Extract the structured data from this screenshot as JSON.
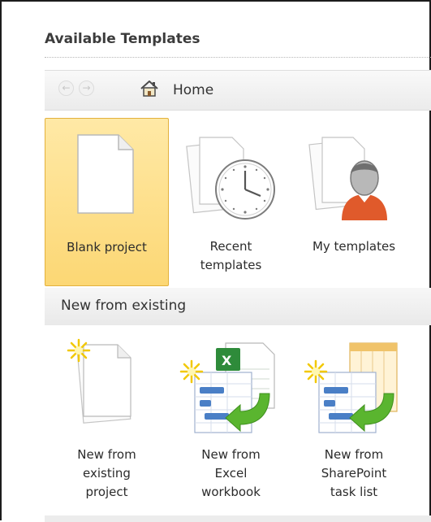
{
  "heading": "Available Templates",
  "navbar": {
    "back_icon": "back-arrow",
    "forward_icon": "forward-arrow",
    "home_label": "Home"
  },
  "tiles_top": [
    {
      "label": "Blank project",
      "icon": "blank-document",
      "selected": true
    },
    {
      "label": "Recent templates",
      "icon": "clock-documents",
      "selected": false
    },
    {
      "label": "My templates",
      "icon": "person-documents",
      "selected": false
    }
  ],
  "section": {
    "title": "New from existing"
  },
  "tiles_bottom": [
    {
      "label": "New from existing project",
      "icon": "new-document-star"
    },
    {
      "label": "New from Excel workbook",
      "icon": "excel-gantt"
    },
    {
      "label": "New from SharePoint task list",
      "icon": "sharepoint-gantt"
    }
  ],
  "colors": {
    "selection": "#fcd774",
    "excel_green": "#2e8b3a",
    "gantt_blue": "#4a7fc6",
    "arrow_green": "#5ab52f"
  },
  "labels": {
    "blank": [
      "Blank project"
    ],
    "recent": [
      "Recent",
      "templates"
    ],
    "mine": [
      "My templates"
    ],
    "existing": [
      "New from",
      "existing",
      "project"
    ],
    "excel": [
      "New from",
      "Excel",
      "workbook"
    ],
    "sharepoint": [
      "New from",
      "SharePoint",
      "task list"
    ]
  }
}
